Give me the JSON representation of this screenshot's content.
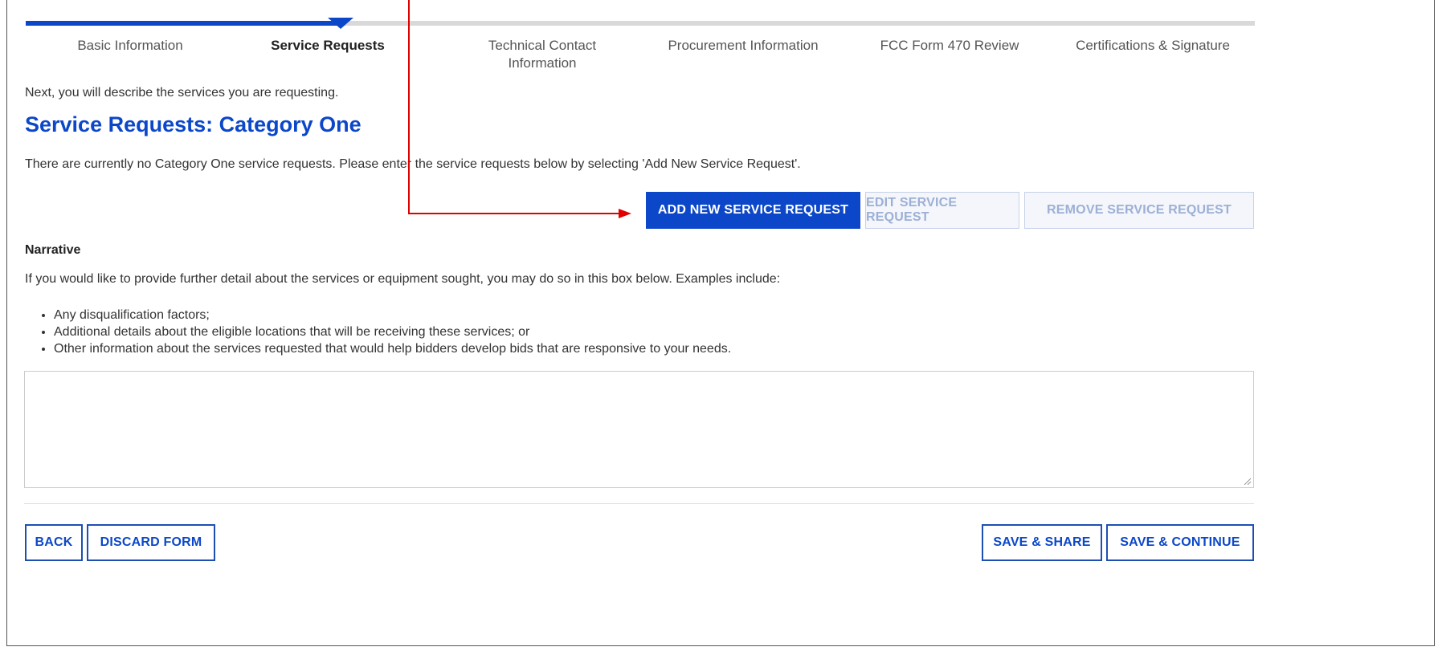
{
  "steps": [
    {
      "label": "Basic Information",
      "active": false
    },
    {
      "label": "Service Requests",
      "active": true
    },
    {
      "label": "Technical Contact Information",
      "active": false
    },
    {
      "label": "Procurement Information",
      "active": false
    },
    {
      "label": "FCC Form 470 Review",
      "active": false
    },
    {
      "label": "Certifications & Signature",
      "active": false
    }
  ],
  "main": {
    "intro": "Next, you will describe the services you are requesting.",
    "title": "Service Requests: Category One",
    "notice": "There are currently no Category One service requests. Please enter the service requests below by selecting 'Add New Service Request'."
  },
  "actions": {
    "add": "ADD NEW SERVICE REQUEST",
    "edit": "EDIT SERVICE REQUEST",
    "remove": "REMOVE SERVICE REQUEST"
  },
  "narrative": {
    "label": "Narrative",
    "description": "If you would like to provide further detail about the services or equipment sought, you may do so in this box below. Examples include:",
    "bullets": [
      "Any disqualification factors;",
      "Additional details about the eligible locations that will be receiving these services; or",
      "Other information about the services requested that would help bidders develop bids that are responsive to your needs."
    ],
    "value": ""
  },
  "footer": {
    "back": "BACK",
    "discard": "DISCARD FORM",
    "save_share": "SAVE & SHARE",
    "save_continue": "SAVE & CONTINUE"
  },
  "colors": {
    "primary": "#0b47c8",
    "annotation": "#e00000"
  }
}
